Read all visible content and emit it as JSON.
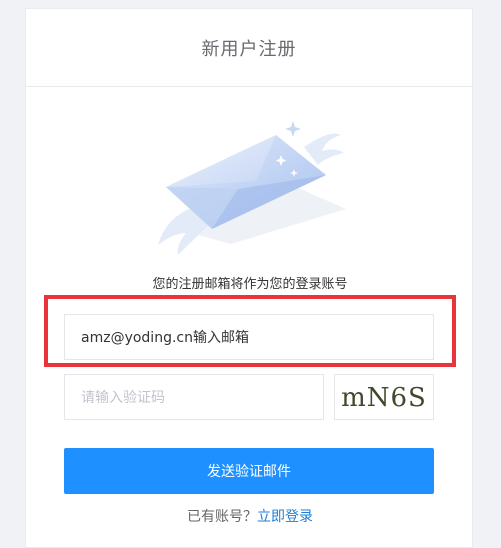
{
  "header": {
    "title": "新用户注册"
  },
  "subtitle": "您的注册邮箱将作为您的登录账号",
  "email": {
    "value": "amz@yoding.cn输入邮箱"
  },
  "code": {
    "placeholder": "请输入验证码"
  },
  "captcha": {
    "text": "mN6S"
  },
  "send_button": {
    "label": "发送验证邮件"
  },
  "login": {
    "prompt": "已有账号？",
    "link": "立即登录"
  },
  "colors": {
    "accent": "#1e90ff",
    "highlight": "#e8343a",
    "link": "#1e7fd6"
  }
}
